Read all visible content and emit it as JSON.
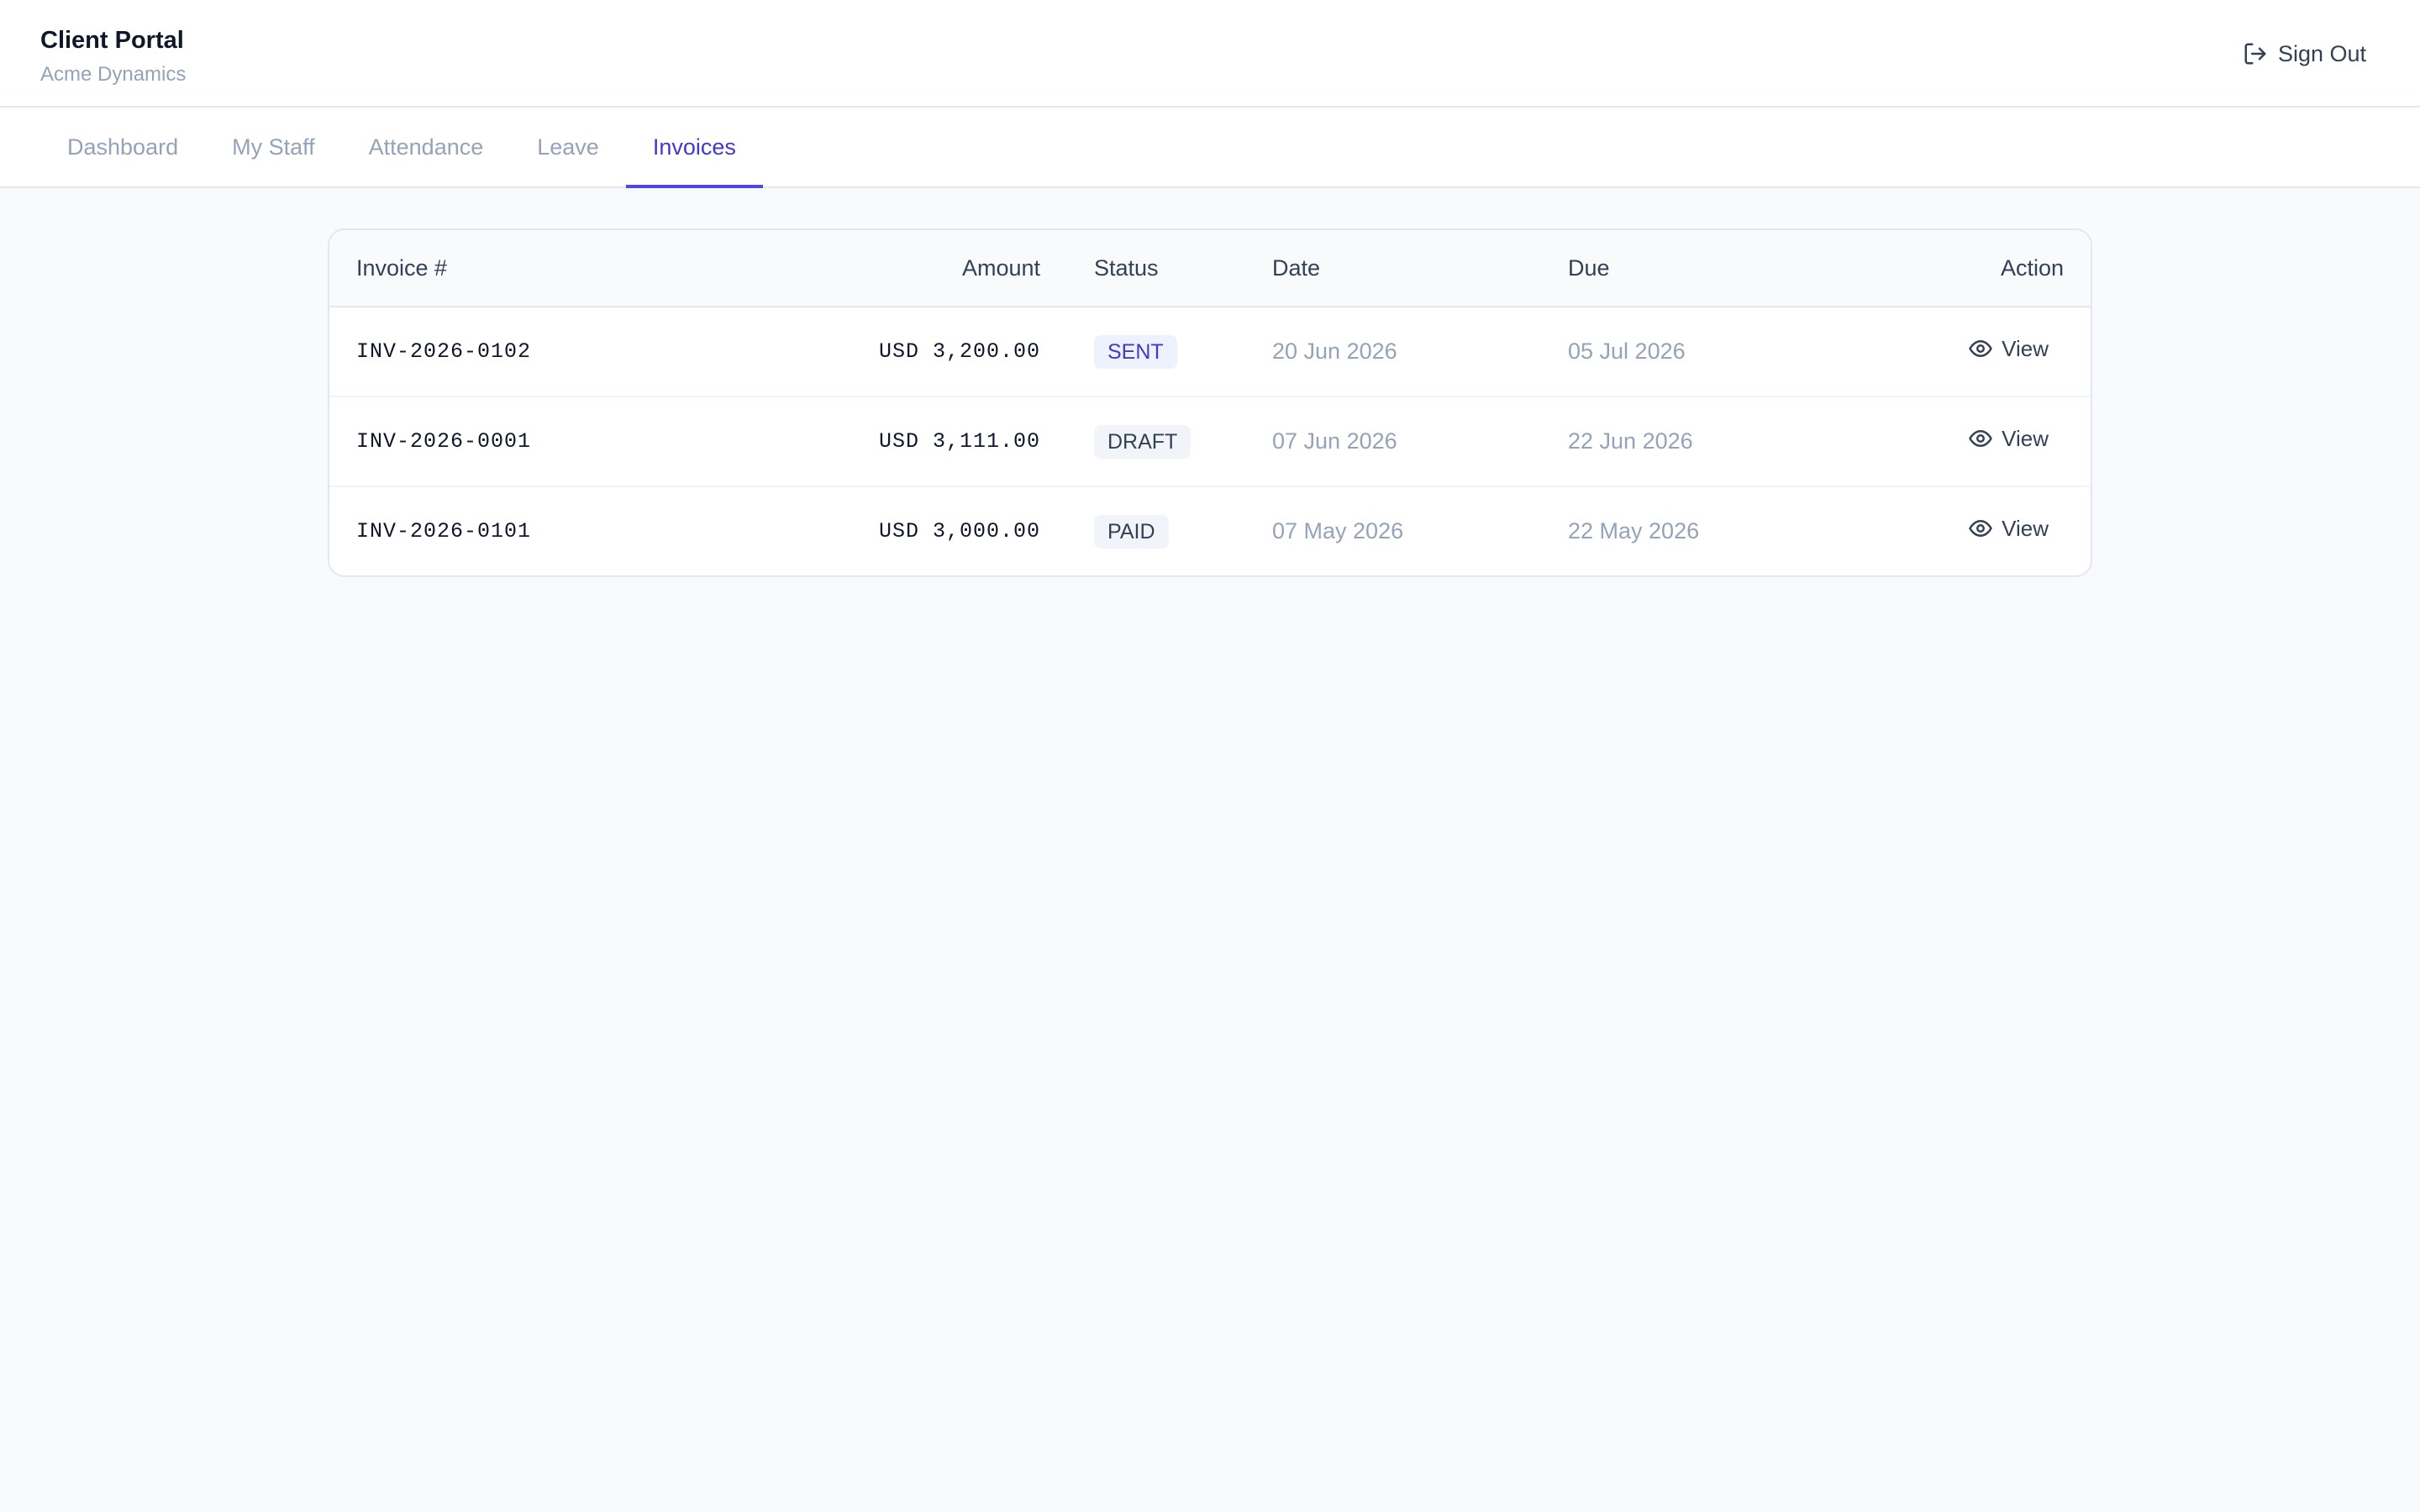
{
  "header": {
    "title": "Client Portal",
    "subtitle": "Acme Dynamics",
    "sign_out_label": "Sign Out"
  },
  "tabs": [
    {
      "label": "Dashboard",
      "active": false
    },
    {
      "label": "My Staff",
      "active": false
    },
    {
      "label": "Attendance",
      "active": false
    },
    {
      "label": "Leave",
      "active": false
    },
    {
      "label": "Invoices",
      "active": true
    }
  ],
  "table": {
    "columns": {
      "invoice": "Invoice #",
      "amount": "Amount",
      "status": "Status",
      "date": "Date",
      "due": "Due",
      "action": "Action"
    },
    "rows": [
      {
        "invoice": "INV-2026-0102",
        "amount": "USD 3,200.00",
        "status": "SENT",
        "date": "20 Jun 2026",
        "due": "05 Jul 2026",
        "action": "View"
      },
      {
        "invoice": "INV-2026-0001",
        "amount": "USD 3,111.00",
        "status": "DRAFT",
        "date": "07 Jun 2026",
        "due": "22 Jun 2026",
        "action": "View"
      },
      {
        "invoice": "INV-2026-0101",
        "amount": "USD 3,000.00",
        "status": "PAID",
        "date": "07 May 2026",
        "due": "22 May 2026",
        "action": "View"
      }
    ]
  },
  "colors": {
    "accent": "#4f46e5",
    "accent_text": "#4338ca",
    "background": "#f8fafc",
    "muted_text": "#94a3b8"
  },
  "icons": {
    "sign_out": "log-out-icon",
    "view": "eye-icon"
  }
}
